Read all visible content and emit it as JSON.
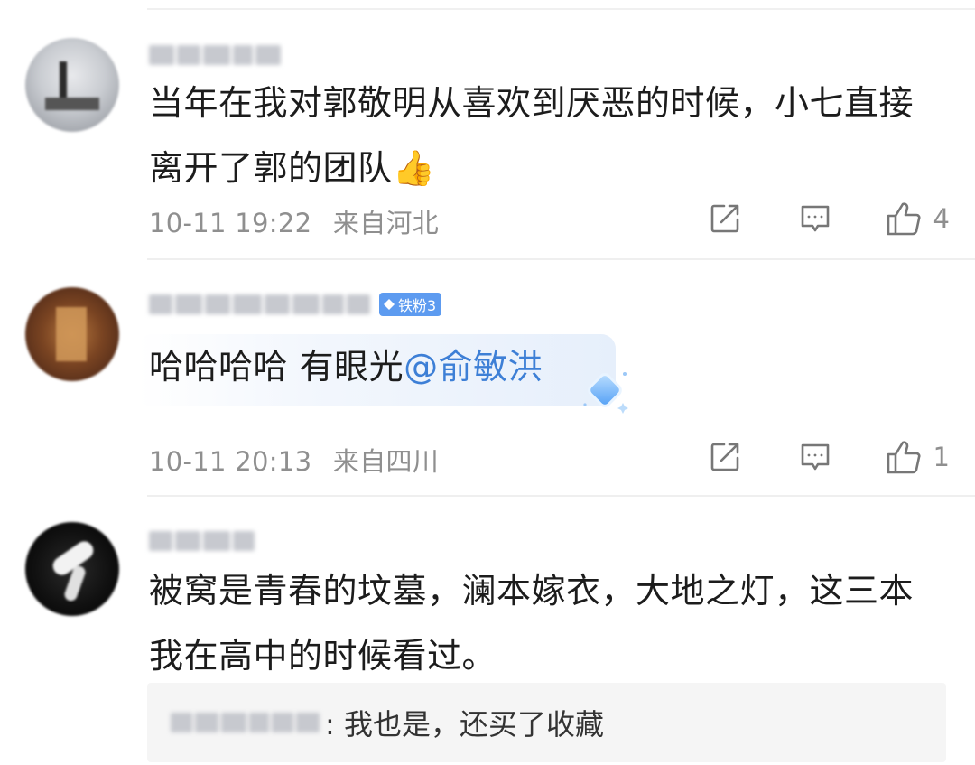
{
  "comments": [
    {
      "text": "当年在我对郭敬明从喜欢到厌恶的时候，小七直接离开了郭的团队",
      "emoji": "👍",
      "time": "10-11 19:22",
      "location": "来自河北",
      "like_count": "4"
    },
    {
      "badge": "铁粉3",
      "text": "哈哈哈哈 有眼光",
      "mention": "@俞敏洪",
      "time": "10-11 20:13",
      "location": "来自四川",
      "like_count": "1"
    },
    {
      "text": "被窝是青春的坟墓，澜本嫁衣，大地之灯，这三本我在高中的时候看过。",
      "time": "",
      "location": "",
      "reply": {
        "text": ": 我也是，还买了收藏"
      }
    }
  ],
  "icons": {
    "share": "share-icon",
    "comment": "comment-icon",
    "like": "like-icon",
    "badge": "diamond-icon"
  },
  "colors": {
    "link": "#3d7fd6",
    "badge": "#5d9bf0",
    "meta": "#8f8f8f"
  }
}
